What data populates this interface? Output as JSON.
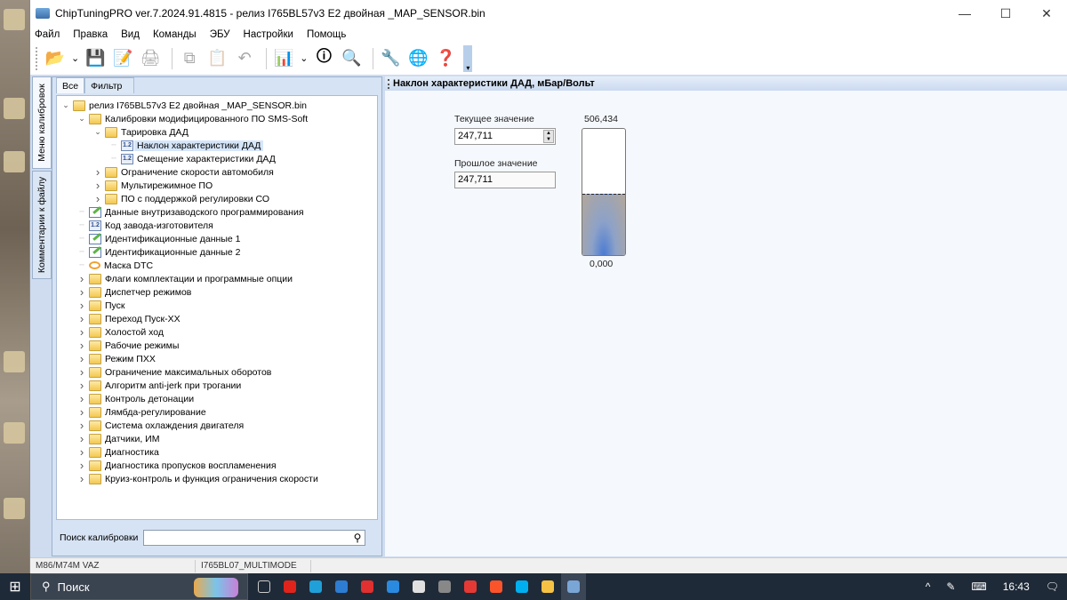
{
  "window": {
    "title": "ChipTuningPRO ver.7.2024.91.4815 - релиз I765BL57v3 E2 двойная  _MAP_SENSOR.bin",
    "minimize": "—",
    "maximize": "☐",
    "close": "✕"
  },
  "menu": [
    "Файл",
    "Правка",
    "Вид",
    "Команды",
    "ЭБУ",
    "Настройки",
    "Помощь"
  ],
  "toolbar": [
    {
      "name": "open-icon",
      "glyph": "📂",
      "disabled": false,
      "dropdown": true
    },
    {
      "name": "save-icon",
      "glyph": "💾",
      "disabled": false
    },
    {
      "name": "save-as-icon",
      "glyph": "📝",
      "disabled": false
    },
    {
      "name": "print-icon",
      "glyph": "🖨",
      "disabled": true
    },
    {
      "sep": true
    },
    {
      "name": "copy-icon",
      "glyph": "⧉",
      "disabled": true
    },
    {
      "name": "paste-icon",
      "glyph": "📋",
      "disabled": true
    },
    {
      "name": "undo-icon",
      "glyph": "↶",
      "disabled": true
    },
    {
      "sep": true
    },
    {
      "name": "chart-icon",
      "glyph": "📊",
      "disabled": false,
      "dropdown": true
    },
    {
      "name": "info-icon",
      "glyph": "🛈",
      "disabled": false
    },
    {
      "name": "search-hex-icon",
      "glyph": "🔍",
      "disabled": false
    },
    {
      "sep": true
    },
    {
      "name": "tools-icon",
      "glyph": "🔧",
      "disabled": false
    },
    {
      "name": "network-icon",
      "glyph": "🌐",
      "disabled": false
    },
    {
      "name": "help-icon",
      "glyph": "❓",
      "disabled": false
    }
  ],
  "side_tabs": {
    "calib_menu": "Меню калибровок",
    "file_comments": "Комментарии к файлу"
  },
  "tabs": {
    "all": "Все",
    "filter": "Фильтр"
  },
  "tree": [
    {
      "level": 0,
      "exp": "open",
      "icon": "folder",
      "label": "релиз I765BL57v3 E2 двойная  _MAP_SENSOR.bin"
    },
    {
      "level": 1,
      "exp": "open",
      "icon": "folder",
      "label": "Калибровки модифицированного ПО SMS-Soft"
    },
    {
      "level": 2,
      "exp": "open",
      "icon": "folder",
      "label": "Тарировка ДАД"
    },
    {
      "level": 3,
      "exp": "",
      "icon": "num",
      "label": "Наклон характеристики ДАД",
      "selected": true
    },
    {
      "level": 3,
      "exp": "",
      "icon": "num",
      "label": "Смещение характеристики ДАД"
    },
    {
      "level": 2,
      "exp": "closed",
      "icon": "folder",
      "label": "Ограничение скорости автомобиля"
    },
    {
      "level": 2,
      "exp": "closed",
      "icon": "folder",
      "label": "Мультирежимное ПО"
    },
    {
      "level": 2,
      "exp": "closed",
      "icon": "folder",
      "label": "ПО с поддержкой регулировки СО"
    },
    {
      "level": 1,
      "exp": "",
      "icon": "edit",
      "label": "Данные внутризаводского программирования"
    },
    {
      "level": 1,
      "exp": "",
      "icon": "num",
      "label": "Код завода-изготовителя"
    },
    {
      "level": 1,
      "exp": "",
      "icon": "edit",
      "label": "Идентификационные данные 1"
    },
    {
      "level": 1,
      "exp": "",
      "icon": "edit",
      "label": "Идентификационные данные 2"
    },
    {
      "level": 1,
      "exp": "",
      "icon": "dtc",
      "label": "Маска DTC"
    },
    {
      "level": 1,
      "exp": "closed",
      "icon": "folder",
      "label": "Флаги комплектации и программные опции"
    },
    {
      "level": 1,
      "exp": "closed",
      "icon": "folder",
      "label": "Диспетчер режимов"
    },
    {
      "level": 1,
      "exp": "closed",
      "icon": "folder",
      "label": "Пуск"
    },
    {
      "level": 1,
      "exp": "closed",
      "icon": "folder",
      "label": "Переход Пуск-ХХ"
    },
    {
      "level": 1,
      "exp": "closed",
      "icon": "folder",
      "label": "Холостой ход"
    },
    {
      "level": 1,
      "exp": "closed",
      "icon": "folder",
      "label": "Рабочие режимы"
    },
    {
      "level": 1,
      "exp": "closed",
      "icon": "folder",
      "label": "Режим ПХХ"
    },
    {
      "level": 1,
      "exp": "closed",
      "icon": "folder",
      "label": "Ограничение максимальных оборотов"
    },
    {
      "level": 1,
      "exp": "closed",
      "icon": "folder",
      "label": "Алгоритм anti-jerk при трогании"
    },
    {
      "level": 1,
      "exp": "closed",
      "icon": "folder",
      "label": "Контроль детонации"
    },
    {
      "level": 1,
      "exp": "closed",
      "icon": "folder",
      "label": "Лямбда-регулирование"
    },
    {
      "level": 1,
      "exp": "closed",
      "icon": "folder",
      "label": "Система охлаждения двигателя"
    },
    {
      "level": 1,
      "exp": "closed",
      "icon": "folder",
      "label": "Датчики, ИМ"
    },
    {
      "level": 1,
      "exp": "closed",
      "icon": "folder",
      "label": "Диагностика"
    },
    {
      "level": 1,
      "exp": "closed",
      "icon": "folder",
      "label": "Диагностика пропусков воспламенения"
    },
    {
      "level": 1,
      "exp": "closed",
      "icon": "folder",
      "label": "Круиз-контроль и функция ограничения скорости"
    }
  ],
  "search": {
    "label": "Поиск калибровки",
    "value": ""
  },
  "editor": {
    "title": "Наклон характеристики ДАД, мБар/Вольт",
    "current_label": "Текущее значение",
    "current_value": "247,711",
    "previous_label": "Прошлое значение",
    "previous_value": "247,711",
    "gauge_max": "506,434",
    "gauge_min": "0,000",
    "gauge_fraction": 0.489
  },
  "status": {
    "ecu": "M86/M74M VAZ",
    "firmware": "I765BL07_MULTIMODE"
  },
  "taskbar": {
    "search_placeholder": "Поиск",
    "time": "16:43",
    "apps": [
      "task-view",
      "opera",
      "edge",
      "solitaire",
      "yandex-music",
      "mail",
      "store",
      "shield",
      "yandex-browser",
      "brave",
      "skype",
      "explorer",
      "chiptuningpro"
    ],
    "app_colors": [
      "#ccc",
      "#e0241b",
      "#1fa0d8",
      "#2d7dd2",
      "#e03030",
      "#2a8ae0",
      "#e0e0e0",
      "#888",
      "#e53935",
      "#fb542b",
      "#00aff0",
      "#f5c243",
      "#7aa6d6"
    ]
  }
}
